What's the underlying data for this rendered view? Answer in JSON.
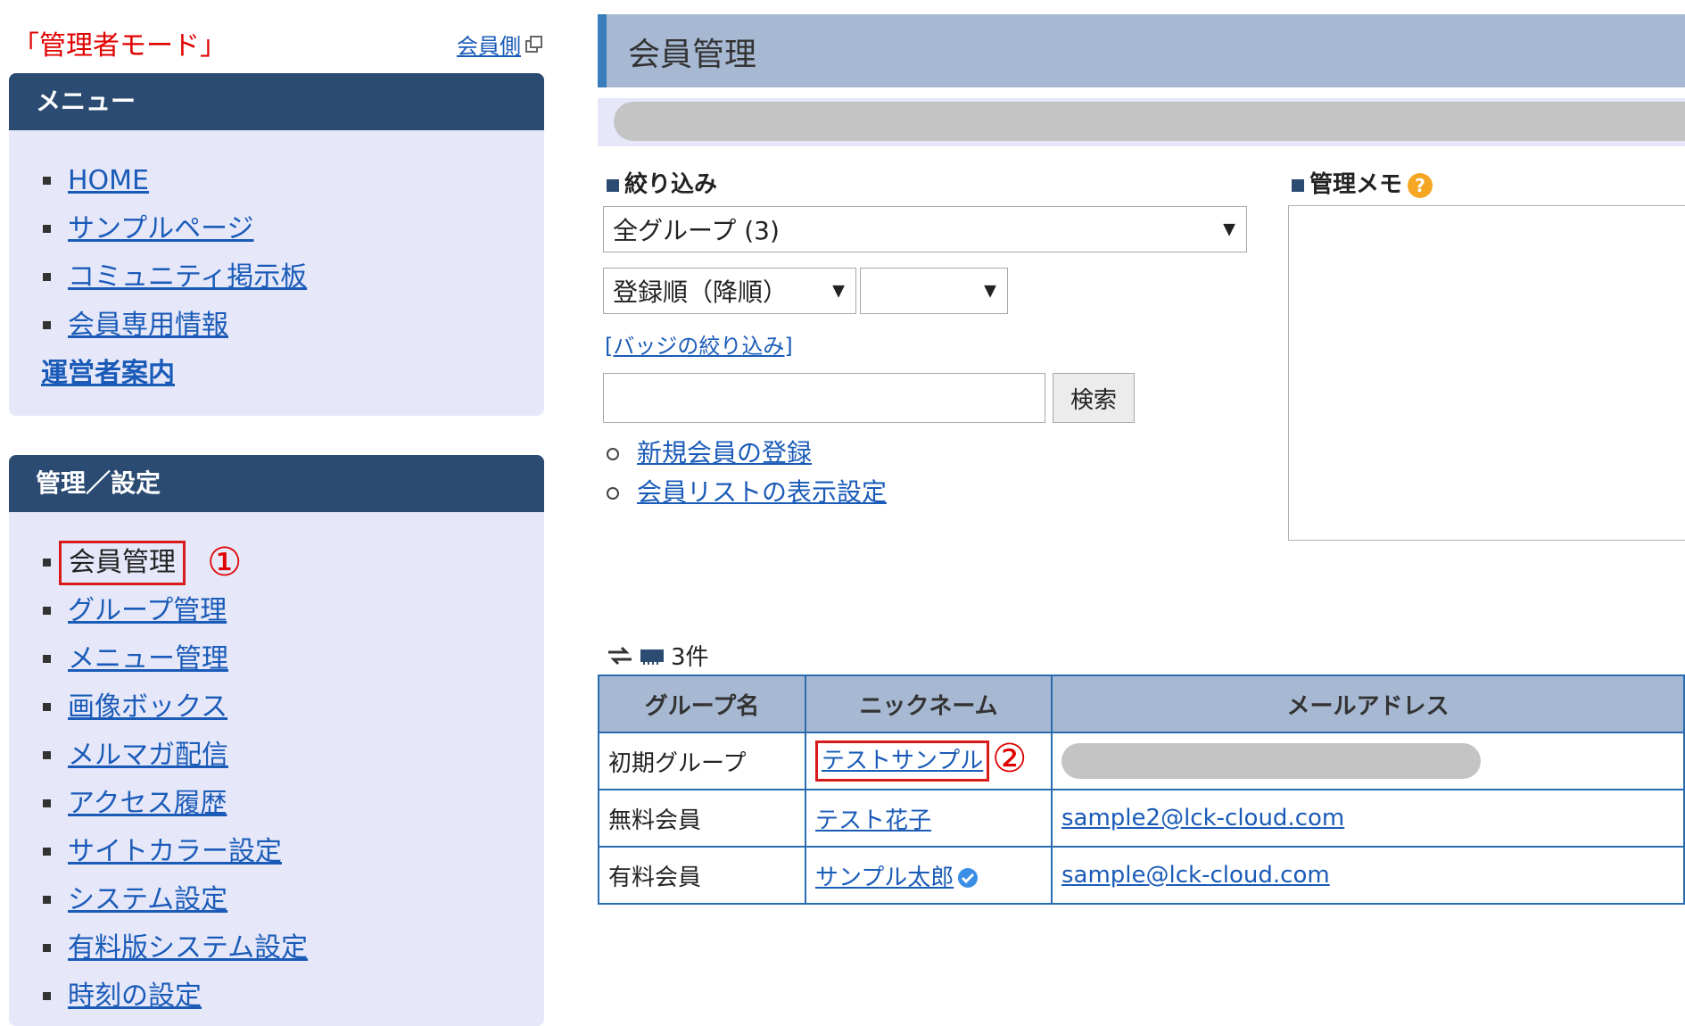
{
  "sidebar": {
    "mode_label": "「管理者モード」",
    "member_side_link": "会員側",
    "menu": {
      "title": "メニュー",
      "items": [
        {
          "label": "HOME"
        },
        {
          "label": "サンプルページ"
        },
        {
          "label": "コミュニティ掲示板"
        },
        {
          "label": "会員専用情報"
        }
      ],
      "operator_link": "運営者案内"
    },
    "admin": {
      "title": "管理／設定",
      "items": [
        {
          "label": "会員管理"
        },
        {
          "label": "グループ管理"
        },
        {
          "label": "メニュー管理"
        },
        {
          "label": "画像ボックス"
        },
        {
          "label": "メルマガ配信"
        },
        {
          "label": "アクセス履歴"
        },
        {
          "label": "サイトカラー設定"
        },
        {
          "label": "システム設定"
        },
        {
          "label": "有料版システム設定"
        },
        {
          "label": "時刻の設定"
        }
      ],
      "marker_1": "①"
    }
  },
  "main": {
    "page_title": "会員管理",
    "filter": {
      "title": "絞り込み",
      "group_select": "全グループ (3)",
      "sort_select": "登録順（降順）",
      "secondary_select": "",
      "badge_filter_link": "[バッジの絞り込み]",
      "search_button": "検索",
      "actions": [
        {
          "label": "新規会員の登録"
        },
        {
          "label": "会員リストの表示設定"
        }
      ]
    },
    "memo": {
      "title": "管理メモ",
      "help": "?"
    },
    "count": "3件",
    "table": {
      "headers": [
        "グループ名",
        "ニックネーム",
        "メールアドレス"
      ],
      "rows": [
        {
          "group": "初期グループ",
          "nickname": "テストサンプル",
          "email": ""
        },
        {
          "group": "無料会員",
          "nickname": "テスト花子",
          "email": "sample2@lck-cloud.com"
        },
        {
          "group": "有料会員",
          "nickname": "サンプル太郎",
          "email": "sample@lck-cloud.com"
        }
      ],
      "marker_2": "②"
    }
  },
  "colors": {
    "panel_header": "#2b4b73",
    "panel_body": "#e6e8fa",
    "title_bar": "#a6b8d2",
    "link": "#1a5bb8",
    "annotation_red": "#d81a1a",
    "help_icon": "#f5a623",
    "verified": "#3a8ee6"
  }
}
